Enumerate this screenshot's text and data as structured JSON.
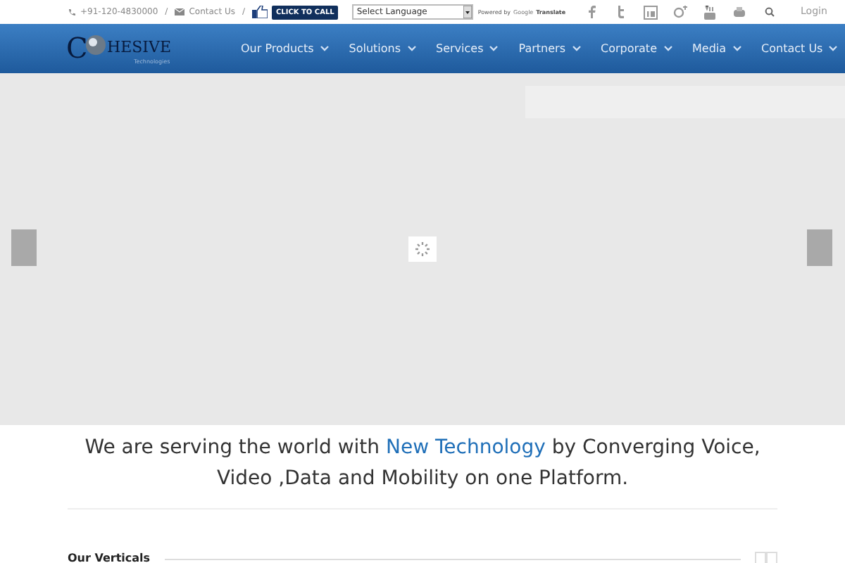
{
  "top_bar": {
    "phone": "+91-120-4830000",
    "separator_1": "/",
    "contact": "Contact Us",
    "separator_2": "/",
    "call_button": "CLICK TO CALL",
    "language_select": {
      "value": "Select Language"
    },
    "powered_by": "Powered by",
    "translate_brand": "Google",
    "translate_word": "Translate",
    "login": "Login"
  },
  "logo": {
    "first_letter": "C",
    "rest": "HESIVE",
    "tagline": "Technologies"
  },
  "nav": [
    {
      "label": "Our Products"
    },
    {
      "label": "Solutions"
    },
    {
      "label": "Services"
    },
    {
      "label": "Partners"
    },
    {
      "label": "Corporate"
    },
    {
      "label": "Media"
    },
    {
      "label": "Contact Us"
    }
  ],
  "headline": {
    "before": "We are serving the world with",
    "highlight": "New Technology",
    "after": "by Converging Voice, Video ,Data and Mobility on one Platform."
  },
  "section": {
    "title": "Our Verticals"
  }
}
